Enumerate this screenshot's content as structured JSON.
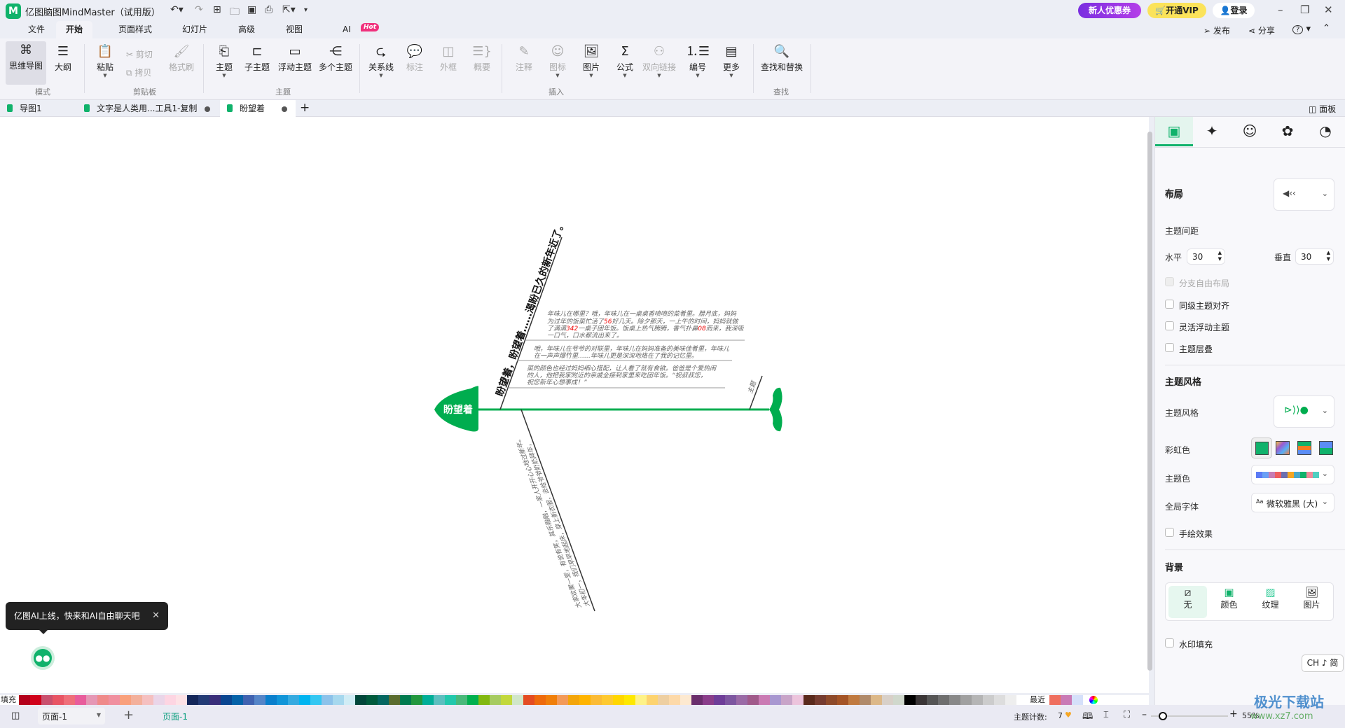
{
  "app": {
    "title": "亿图脑图MindMaster（试用版）",
    "logo": "M"
  },
  "titlebar": {
    "promo": "新人优惠券",
    "vip": "开通VIP",
    "login": "登录",
    "publish": "发布",
    "share": "分享",
    "help": "?"
  },
  "menu_tabs": [
    {
      "label": "文件"
    },
    {
      "label": "开始"
    },
    {
      "label": "页面样式"
    },
    {
      "label": "幻灯片"
    },
    {
      "label": "高级"
    },
    {
      "label": "视图"
    },
    {
      "label": "AI",
      "badge": "Hot"
    }
  ],
  "ribbon": {
    "mode": {
      "mindmap": "思维导图",
      "outline": "大纲",
      "label": "模式"
    },
    "clipboard": {
      "paste": "粘贴",
      "cut": "剪切",
      "copy": "拷贝",
      "format_painter": "格式刷",
      "label": "剪贴板"
    },
    "topic": {
      "topic": "主题",
      "subtopic": "子主题",
      "floating": "浮动主题",
      "multiple": "多个主题",
      "label": "主题"
    },
    "insert": {
      "relation": "关系线",
      "callout": "标注",
      "boundary": "外框",
      "summary": "概要",
      "note": "注释",
      "icon": "图标",
      "picture": "图片",
      "formula": "公式",
      "bilink": "双向链接",
      "numbering": "编号",
      "more": "更多",
      "label": "插入"
    },
    "find": {
      "find_replace": "查找和替换",
      "label": "查找"
    }
  },
  "doc_tabs": [
    {
      "label": "导图1"
    },
    {
      "label": "文字是人类用...工具1-复制"
    },
    {
      "label": "盼望着"
    }
  ],
  "panel_toggle": "面板",
  "fishbone": {
    "head": "盼望着",
    "main_branch": "盼望着，盼望着……渴盼已久的新年近了。",
    "block1": [
      [
        "年味儿在哪里？哦，年味儿在一桌桌香喷喷的菜肴里。腊月底，妈妈"
      ],
      [
        "为过年的饭菜忙活了",
        "56",
        "好几天。除夕那天，一上午的时间，妈妈就做"
      ],
      [
        "了满满",
        "342",
        "一桌子团年饭。饭桌上热气腾腾，香气扑鼻",
        "08",
        "而来，我深吸"
      ],
      [
        "一口气，口水都流出来了。"
      ]
    ],
    "block2": [
      "哦，年味儿在爷爷的对联里，年味儿在妈妈准备的美味佳肴里，年味儿",
      "在一声声爆竹里……年味儿更是深深地烙在了我的记忆里。"
    ],
    "block3": [
      "菜的颜色也经过妈妈细心搭配，让人看了就有食欲。爸爸是个爱热闹",
      "的人，他把我家附近的亲戚全接到家里来吃团年饭。“祝叔叔您，",
      "祝您新年心想事成！”"
    ],
    "small_branch": "主题",
    "lower_branch": [
      "大年初一，我们早早地起床，穿上新衣服，去给爷爷奶奶拜年，",
      "大家欢聚一堂，有说有笑，其乐融融，一家人开开心心地过新年。"
    ]
  },
  "ai_tip": {
    "text": "亿图AI上线，快来和AI自由聊天吧"
  },
  "panel": {
    "layout_heading": "布局",
    "layout_label": "布局",
    "spacing_label": "主题间距",
    "horizontal_label": "水平",
    "horizontal_value": "30",
    "vertical_label": "垂直",
    "vertical_value": "30",
    "checks": [
      {
        "label": "分支自由布局",
        "disabled": true
      },
      {
        "label": "同级主题对齐"
      },
      {
        "label": "灵活浮动主题"
      },
      {
        "label": "主题层叠"
      }
    ],
    "style_heading": "主题风格",
    "style_label": "主题风格",
    "rainbow_label": "彩虹色",
    "theme_color_label": "主题色",
    "font_label": "全局字体",
    "font_value": "微软雅黑 (大)",
    "handdrawn_label": "手绘效果",
    "bg_heading": "背景",
    "bg_options": [
      {
        "label": "无"
      },
      {
        "label": "颜色"
      },
      {
        "label": "纹理"
      },
      {
        "label": "图片"
      }
    ],
    "watermark_label": "水印填充",
    "ime": "CH ♪ 简",
    "theme_colors": [
      "#5b7bf5",
      "#6aa0f5",
      "#c77db5",
      "#ef5f5f",
      "#6c70b0",
      "#f5a623",
      "#4aa8c8",
      "#10b26b",
      "#f08a9a",
      "#4fcfc0"
    ]
  },
  "palette": {
    "label": "填充",
    "recent_label": "最近",
    "colors": [
      "#b3001b",
      "#d0021b",
      "#c9506e",
      "#e85565",
      "#ef6f7a",
      "#e85d9c",
      "#e597b5",
      "#ef8a8a",
      "#f08f9f",
      "#f9a07c",
      "#f3b09b",
      "#f5c0c0",
      "#ead5e8",
      "#fdd5e2",
      "#fde2e6",
      "#14275a",
      "#233b75",
      "#3a2e7a",
      "#0a4590",
      "#0562a8",
      "#4062b0",
      "#5585c8",
      "#0a7fcc",
      "#1195d8",
      "#35aae0",
      "#00b4f0",
      "#33c7f2",
      "#8cc2ea",
      "#a6d8ee",
      "#d0ecf5",
      "#01463a",
      "#005a3c",
      "#046660",
      "#5a6c2e",
      "#007a4e",
      "#22973e",
      "#00ae98",
      "#5cbfbf",
      "#22c8ac",
      "#49b97a",
      "#00b04f",
      "#82b810",
      "#a6cb60",
      "#c2d83c",
      "#d0e6c8",
      "#e44c22",
      "#ee6a0c",
      "#f07f0a",
      "#f39a58",
      "#f3a50a",
      "#ffb400",
      "#fbbb35",
      "#fec930",
      "#ffd600",
      "#fee800",
      "#fef287",
      "#fdd36f",
      "#eecfa1",
      "#fdd9a8",
      "#fde9d0",
      "#6a2e6c",
      "#8a3d8a",
      "#6e3d98",
      "#7d56a0",
      "#9a6aa6",
      "#a05a8a",
      "#ca7ab3",
      "#a897d0",
      "#c8a4c8",
      "#ecc4dc",
      "#5a2a1c",
      "#763c30",
      "#8e4a2a",
      "#a45426",
      "#c07a40",
      "#b08a6a",
      "#dcb888",
      "#d8d0c8",
      "#d0d8cc",
      "#000000",
      "#3a3536",
      "#555555",
      "#6e6e6e",
      "#888888",
      "#a0a0a0",
      "#b5b5b5",
      "#cccccc",
      "#dddddd",
      "#eeeeee"
    ],
    "recent": [
      "#ef6f5f",
      "#c97ab5",
      "#d5e0fa"
    ]
  },
  "status": {
    "page_select": "页面-1",
    "page_tab": "页面-1",
    "topic_count_label": "主题计数:",
    "topic_count": "7",
    "zoom": "55%",
    "zoom_level": 55,
    "watermark": "极光下载站",
    "watermark_url": "www.xz7.com"
  },
  "colors": {
    "accent": "#10b26b",
    "fish": "#00ad4f"
  }
}
